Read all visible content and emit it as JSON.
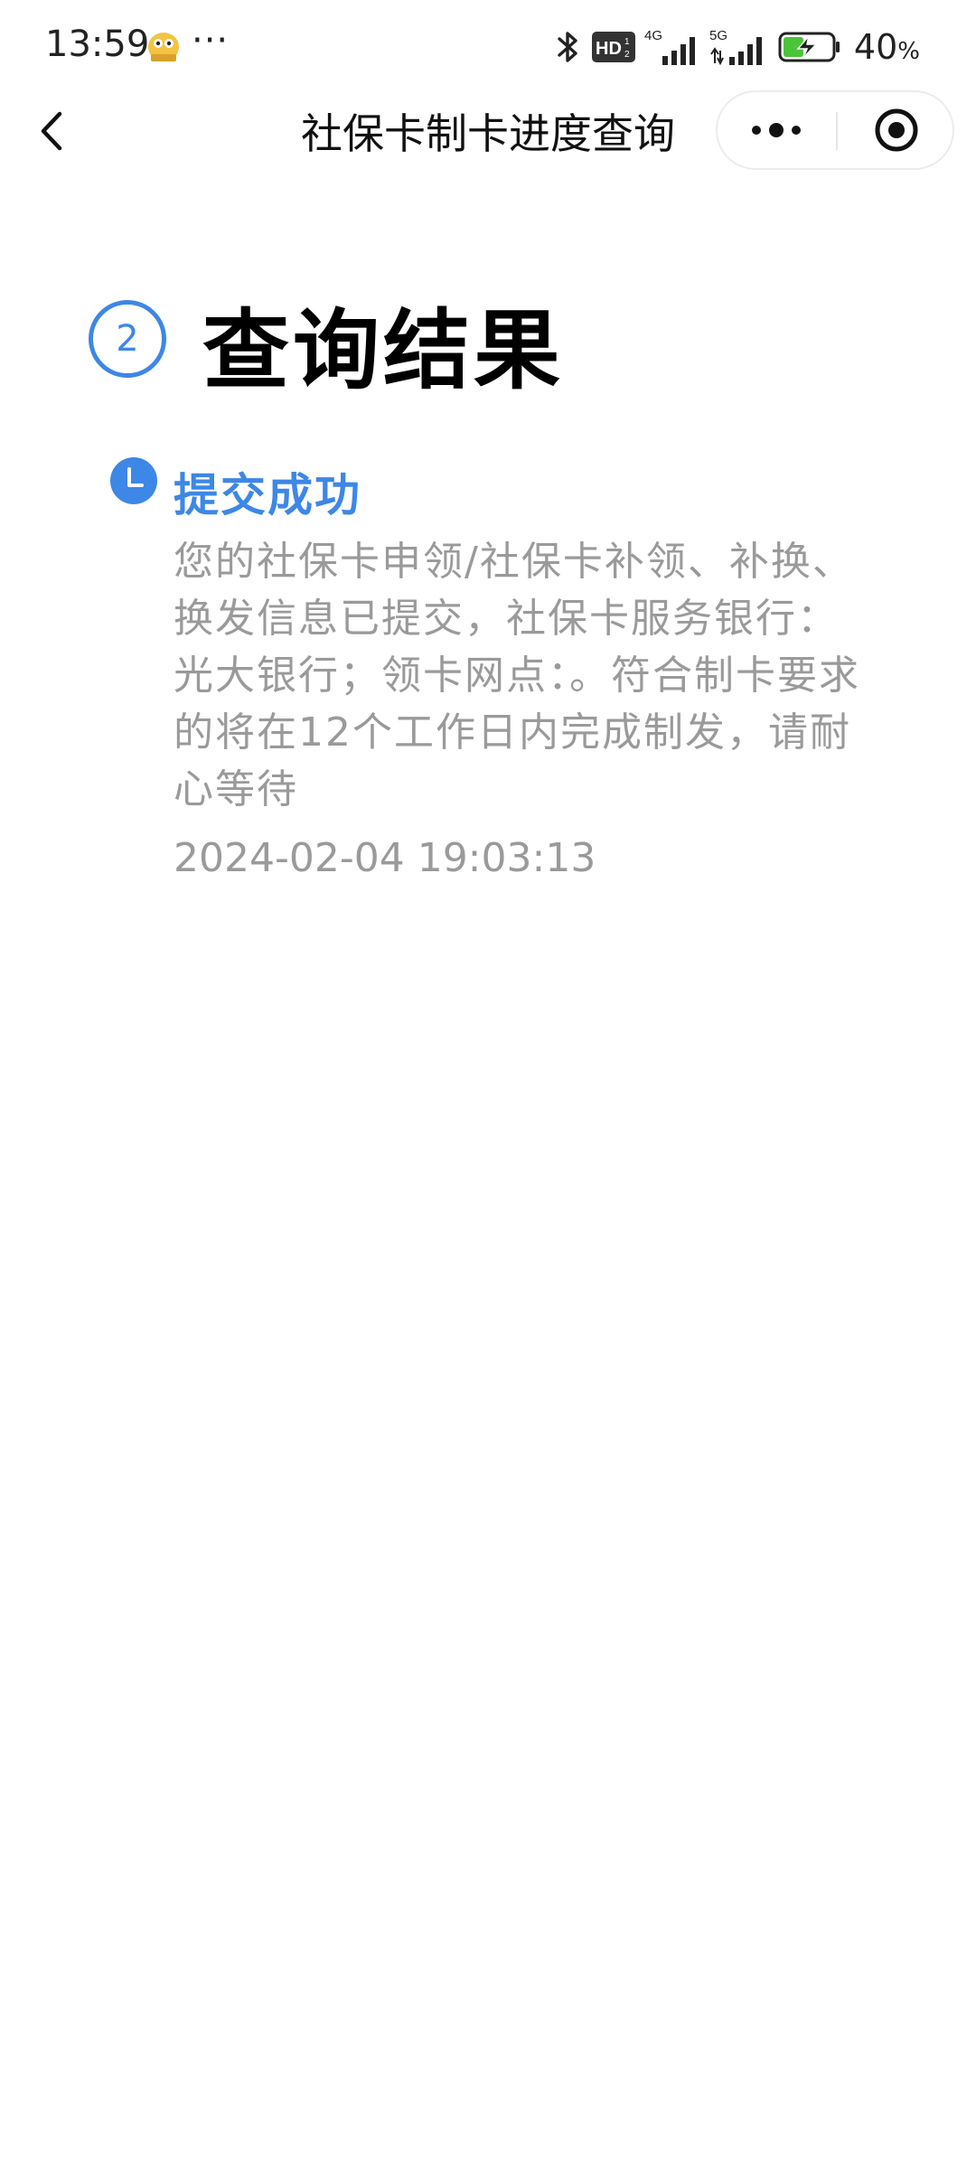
{
  "status_bar": {
    "time": "13:59",
    "more": "···",
    "network_4g": "4G",
    "network_5g": "5G",
    "hd_label": "HD",
    "battery_percent": "40",
    "battery_unit": "%"
  },
  "navbar": {
    "title": "社保卡制卡进度查询"
  },
  "result": {
    "step_number": "2",
    "heading": "查询结果",
    "status_title": "提交成功",
    "status_description": "您的社保卡申领/社保卡补领、补换、换发信息已提交，社保卡服务银行：光大银行；领卡网点：。符合制卡要求的将在12个工作日内完成制发，请耐心等待",
    "timestamp": "2024-02-04 19:03:13"
  },
  "colors": {
    "accent": "#3d87e6",
    "muted_text": "#9a9a9a",
    "battery_green": "#4cc43a"
  },
  "icons": {
    "back": "chevron-left-icon",
    "more": "more-dots-icon",
    "close": "target-close-icon",
    "status": "clock-icon",
    "bluetooth": "bluetooth-icon",
    "battery": "battery-charging-icon"
  }
}
